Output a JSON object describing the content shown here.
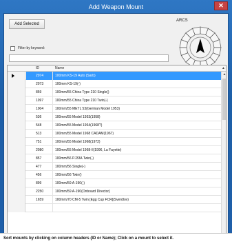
{
  "window": {
    "title": "Add Weapon Mount",
    "close_glyph": "✕"
  },
  "toolbar": {
    "add_selected_label": "Add Selected"
  },
  "arcs": {
    "label": "ARCS"
  },
  "filter": {
    "label": "Filter by keyword:",
    "checked": false,
    "value": "",
    "placeholder": ""
  },
  "grid": {
    "columns": {
      "id": "ID",
      "name": "Name"
    },
    "sort_indicator": "▲",
    "rows": [
      {
        "id": "2074",
        "name": "100mm KS-19 Auto (Sarb)",
        "selected": true
      },
      {
        "id": "2073",
        "name": "100mm KS-19(-)"
      },
      {
        "id": "859",
        "name": "100mm/55 China Type 210 Single()"
      },
      {
        "id": "1097",
        "name": "100mm/55 China Type 210 Twin(-)"
      },
      {
        "id": "1004",
        "name": "100mm/55 METL 53(German Model 1953)"
      },
      {
        "id": "536",
        "name": "100mm/55 Model 1953(1958)"
      },
      {
        "id": "548",
        "name": "100mm/55 Model 1964(1968?)"
      },
      {
        "id": "513",
        "name": "100mm/55 Model 1968 CADAM(1967)"
      },
      {
        "id": "751",
        "name": "100mm/55 Model 1968(1972)"
      },
      {
        "id": "2080",
        "name": "100mm/55 Model 1968-II(1996, La Fayette)"
      },
      {
        "id": "857",
        "name": "100mm/56 PJ33A Twin(-)"
      },
      {
        "id": "477",
        "name": "100mm/56 Single(-)"
      },
      {
        "id": "456",
        "name": "100mm/56 Twin()"
      },
      {
        "id": "899",
        "name": "100mm/59 A-190(-)"
      },
      {
        "id": "2250",
        "name": "100mm/59 A-190(Onboard Director)"
      },
      {
        "id": "1659",
        "name": "100mm/70 CM-5 Twin [Egg Cup FCR](Sverdlov)"
      },
      {
        "id": "",
        "name": ""
      }
    ]
  },
  "status": {
    "text": "Sort mounts by clicking on column headers (ID or Name); Click on a mount to select it."
  }
}
